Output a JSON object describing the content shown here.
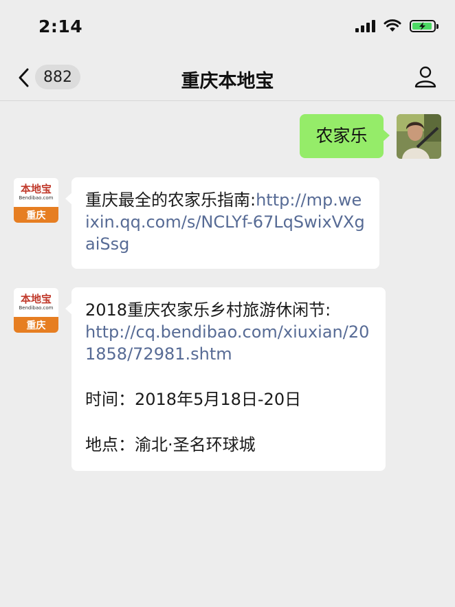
{
  "status_bar": {
    "time": "2:14"
  },
  "nav": {
    "unread_count": "882",
    "title": "重庆本地宝"
  },
  "bot_avatar": {
    "logo_text": "本地宝",
    "logo_sub": "Bendibao.com",
    "city": "重庆"
  },
  "messages": [
    {
      "sender": "self",
      "text": "农家乐"
    },
    {
      "sender": "bot",
      "text": "重庆最全的农家乐指南:",
      "link": "http://mp.weixin.qq.com/s/NCLYf-67LqSwixVXgaiSsg"
    },
    {
      "sender": "bot",
      "text": "2018重庆农家乐乡村旅游休闲节:",
      "link": "http://cq.bendibao.com/xiuxian/201858/72981.shtm",
      "time_line": "时间：2018年5月18日-20日",
      "place_line": "地点：渝北·圣名环球城"
    }
  ],
  "colors": {
    "self_bubble": "#95ec69",
    "link": "#576b95",
    "background": "#ededed"
  }
}
